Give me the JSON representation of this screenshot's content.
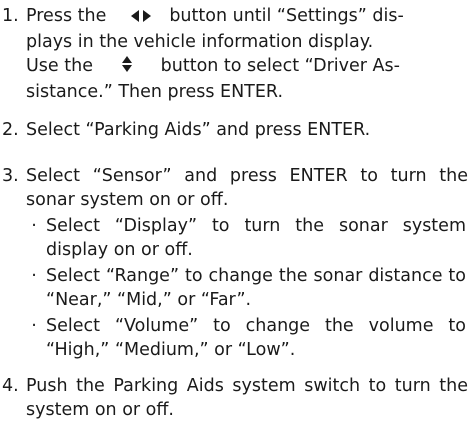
{
  "steps": [
    {
      "num": "1.",
      "line1_a": "Press the",
      "icon1": "left-right-arrows-icon",
      "line1_b": "button until “Settings” dis-",
      "line2": "plays in the vehicle information display.",
      "line3_a": "Use the",
      "icon2": "up-down-arrows-icon",
      "line3_b": "button to select “Driver As-",
      "line4": "sistance.” Then press ENTER."
    },
    {
      "num": "2.",
      "text": "Select “Parking Aids” and press ENTER."
    },
    {
      "num": "3.",
      "text": "Select “Sensor” and press ENTER to turn the sonar system on or off.",
      "bullets": [
        "Select “Display” to turn the sonar system display on or off.",
        "Select “Range” to change the sonar distance to “Near,” “Mid,” or “Far”.",
        "Select “Volume” to change the volume to “High,” “Medium,” or “Low”."
      ]
    },
    {
      "num": "4.",
      "text": "Push the Parking Aids system switch to turn the system on or off."
    }
  ]
}
